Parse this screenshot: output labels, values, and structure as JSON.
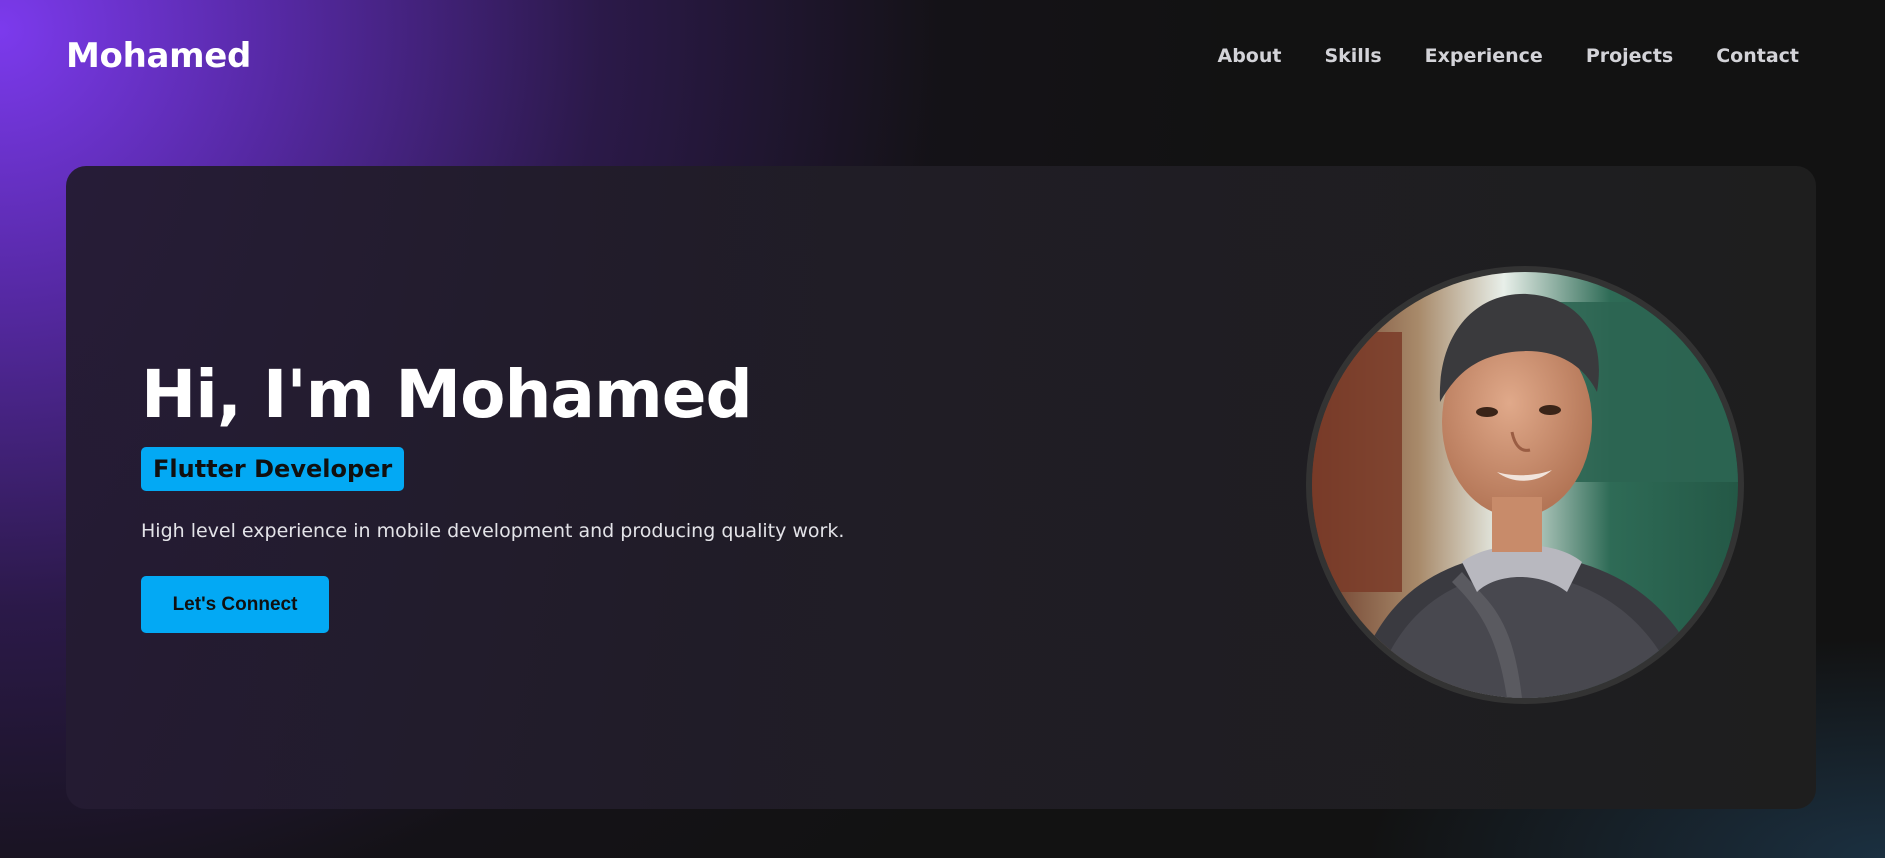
{
  "header": {
    "logo": "Mohamed",
    "nav": [
      {
        "label": "About"
      },
      {
        "label": "Skills"
      },
      {
        "label": "Experience"
      },
      {
        "label": "Projects"
      },
      {
        "label": "Contact"
      }
    ]
  },
  "hero": {
    "title": "Hi, I'm Mohamed",
    "role": "Flutter Developer",
    "description": "High level experience in mobile development and producing quality work.",
    "cta_label": "Let's Connect",
    "photo_icon": "profile-photo"
  },
  "colors": {
    "accent": "#03a9f4",
    "purple_glow": "#7c3aed",
    "background": "#121212",
    "card": "#1e1e1e"
  }
}
